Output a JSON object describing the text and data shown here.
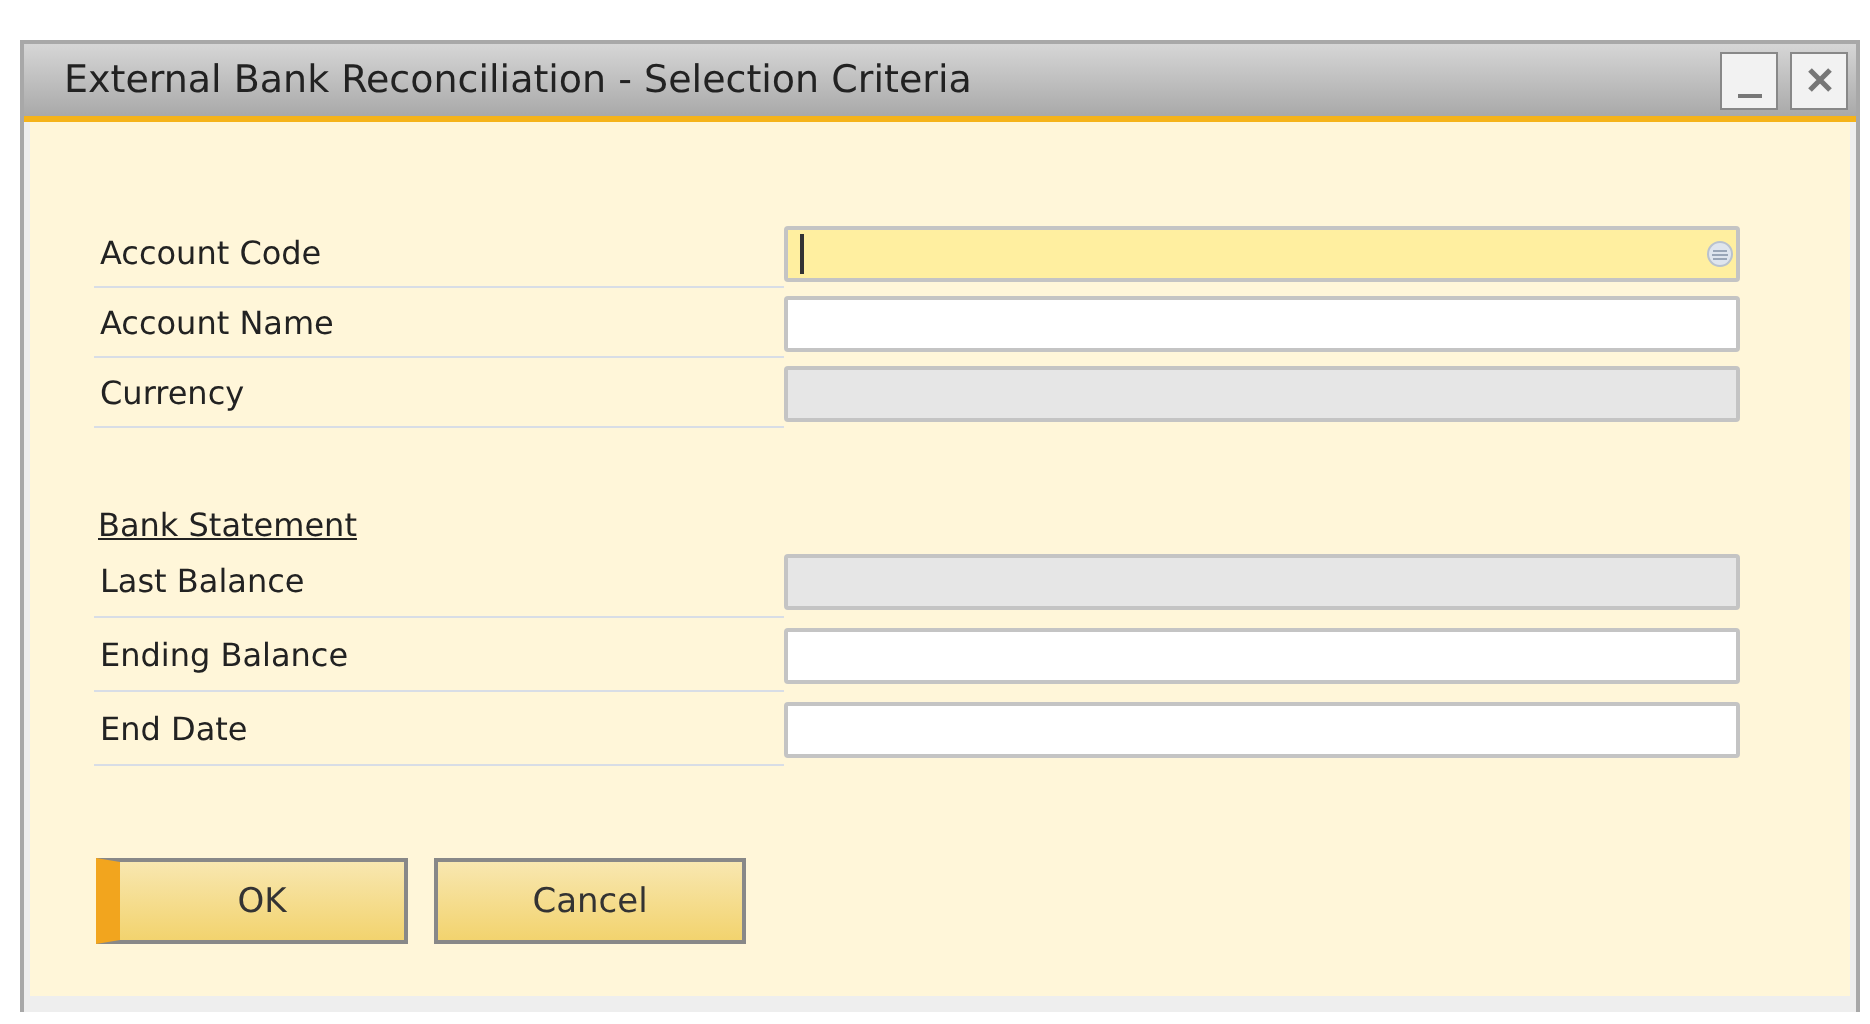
{
  "window": {
    "title": "External Bank Reconciliation - Selection Criteria",
    "controls": [
      {
        "kind": "minimize"
      },
      {
        "kind": "close"
      }
    ]
  },
  "groups": [
    {
      "fields": [
        {
          "label": "Account Code",
          "focused": true,
          "disabled": false,
          "lookup": true
        },
        {
          "label": "Account Name",
          "focused": false,
          "disabled": false,
          "lookup": false
        },
        {
          "label": "Currency",
          "focused": false,
          "disabled": true,
          "lookup": false
        }
      ]
    },
    {
      "heading": "Bank Statement",
      "fields": [
        {
          "label": "Last Balance",
          "focused": false,
          "disabled": true,
          "lookup": false
        },
        {
          "label": "Ending Balance",
          "focused": false,
          "disabled": false,
          "lookup": false
        },
        {
          "label": "End Date",
          "focused": false,
          "disabled": false,
          "lookup": false
        }
      ]
    }
  ],
  "buttons": [
    {
      "label": "OK",
      "default": true
    },
    {
      "label": "Cancel",
      "default": false
    }
  ]
}
